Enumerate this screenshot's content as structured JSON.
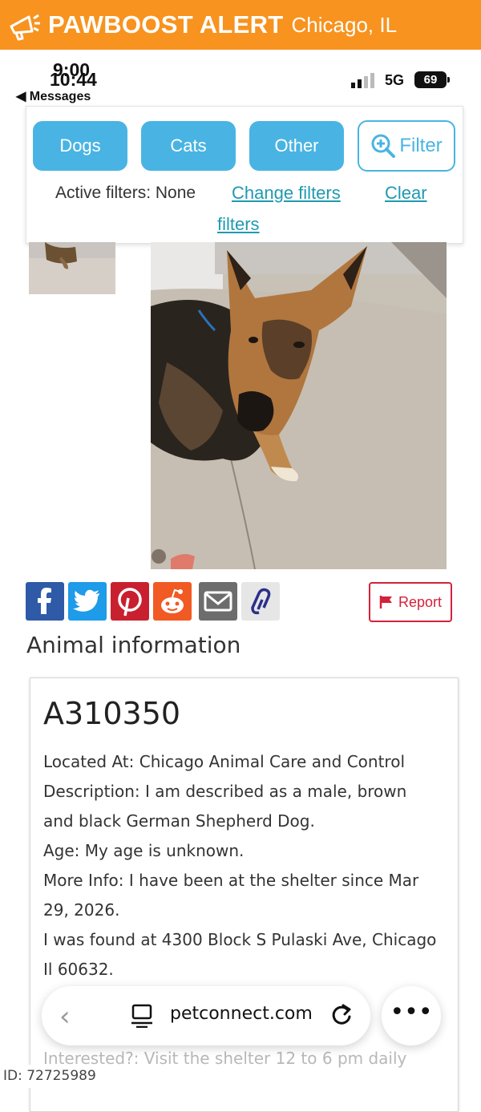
{
  "alert_bar": {
    "brand": "PAWBOOST ALERT",
    "location": "Chicago, IL",
    "icon": "megaphone-icon",
    "color": "#f7931e"
  },
  "status_bar": {
    "time_behind": "9:00",
    "time": "10:44",
    "back_label": "◀ Messages",
    "network": "5G",
    "battery": "69"
  },
  "filters": {
    "pills": [
      "Dogs",
      "Cats",
      "Other"
    ],
    "filter_button": "Filter",
    "active_label": "Active filters: None",
    "change_link": "Change filters",
    "clear_link_1": "Clear",
    "clear_link_2": "filters",
    "accent": "#49b4e3",
    "link_color": "#1f9ab0"
  },
  "share": {
    "icons": [
      "facebook-icon",
      "twitter-icon",
      "pinterest-icon",
      "reddit-icon",
      "email-icon",
      "link-icon"
    ],
    "report_label": "Report"
  },
  "animal": {
    "section_title": "Animal information",
    "id": "A310350",
    "lines": [
      "Located At: Chicago Animal Care and Control",
      "Description: I am described as a male, brown",
      "and black German Shepherd Dog.",
      "Age: My age is unknown.",
      "More Info: I have been at the shelter since Mar",
      "29, 2026.",
      "I was found at 4300 Block S Pulaski Ave, Chicago",
      "Il 60632."
    ],
    "faded_lines": [
      "Interested?: Visit the shelter 12 to 6 pm daily"
    ]
  },
  "browser": {
    "url": "petconnect.com",
    "back_glyph": "‹",
    "more_glyph": "•••"
  },
  "watermark": "ID: 72725989"
}
